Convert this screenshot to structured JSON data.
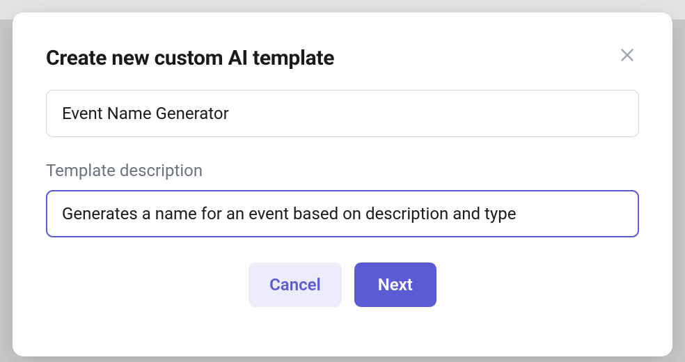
{
  "modal": {
    "title": "Create new custom AI template",
    "name_input": {
      "value": "Event Name Generator"
    },
    "description_label": "Template description",
    "description_input": {
      "value": "Generates a name for an event based on description and type"
    },
    "buttons": {
      "cancel": "Cancel",
      "next": "Next"
    }
  }
}
